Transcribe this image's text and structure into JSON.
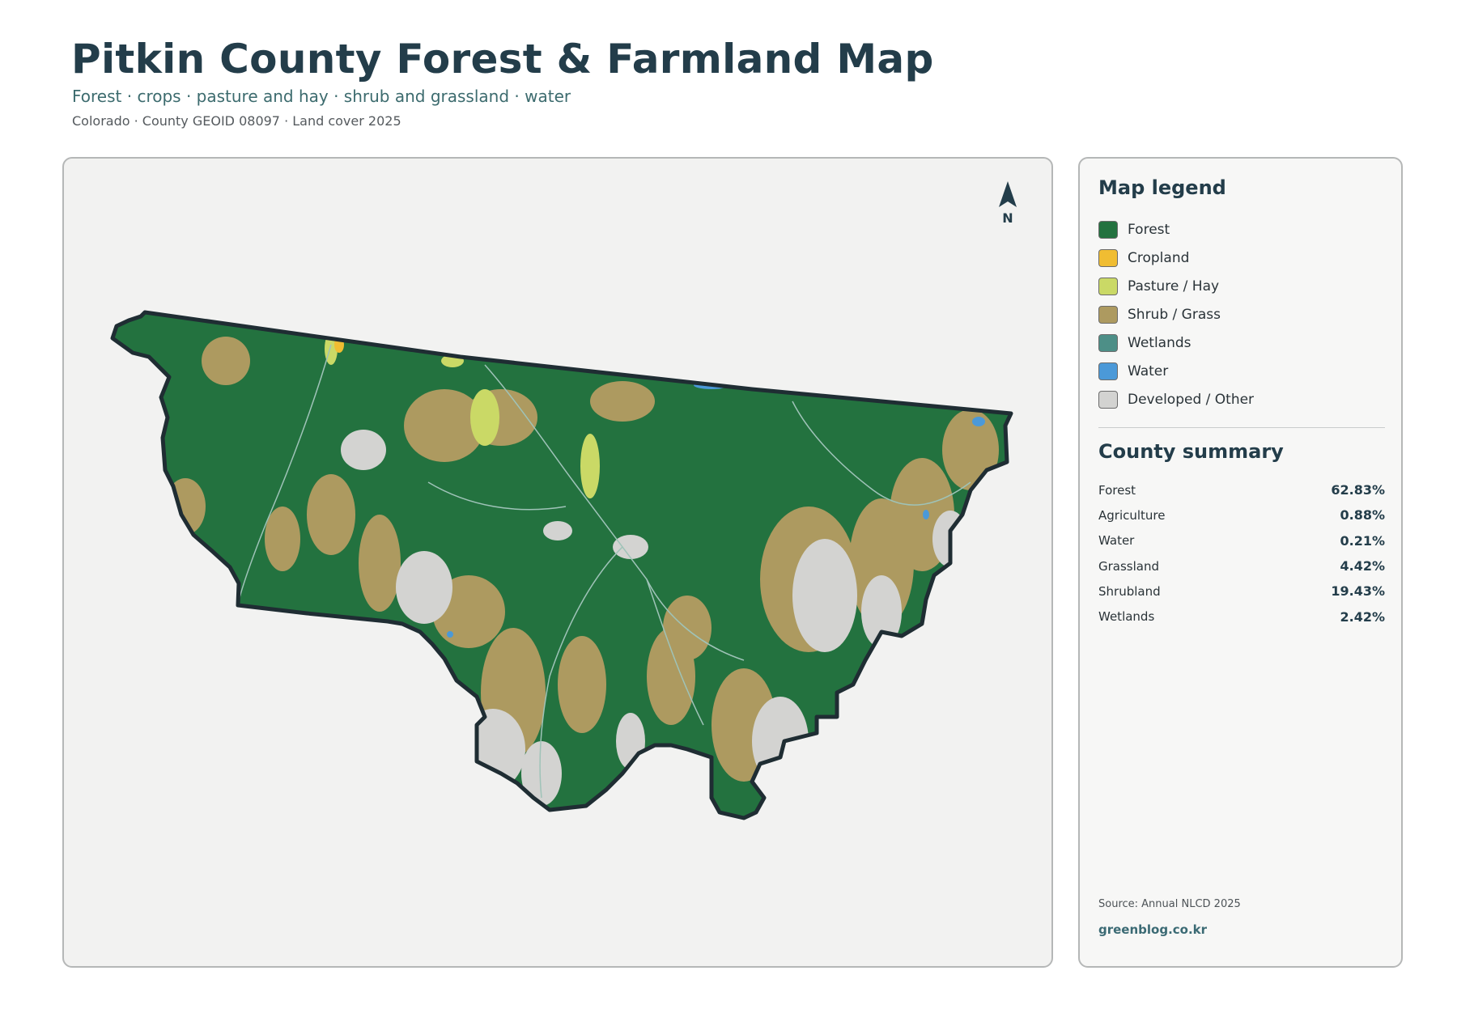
{
  "header": {
    "title": "Pitkin County Forest & Farmland Map",
    "subtitle": "Forest · crops · pasture and hay · shrub and grassland · water",
    "meta": "Colorado · County GEOID 08097 · Land cover 2025"
  },
  "map": {
    "north_label": "N"
  },
  "legend": {
    "title": "Map legend",
    "items": [
      {
        "label": "Forest",
        "color": "#23723f"
      },
      {
        "label": "Cropland",
        "color": "#f0bd32"
      },
      {
        "label": "Pasture / Hay",
        "color": "#cad966"
      },
      {
        "label": "Shrub / Grass",
        "color": "#ad9a60"
      },
      {
        "label": "Wetlands",
        "color": "#4d8f87"
      },
      {
        "label": "Water",
        "color": "#4b99d8"
      },
      {
        "label": "Developed / Other",
        "color": "#d3d3d1"
      }
    ]
  },
  "summary": {
    "title": "County summary",
    "rows": [
      {
        "name": "Forest",
        "value": "62.83%"
      },
      {
        "name": "Agriculture",
        "value": "0.88%"
      },
      {
        "name": "Water",
        "value": "0.21%"
      },
      {
        "name": "Grassland",
        "value": "4.42%"
      },
      {
        "name": "Shrubland",
        "value": "19.43%"
      },
      {
        "name": "Wetlands",
        "value": "2.42%"
      }
    ]
  },
  "footer": {
    "source": "Source: Annual NLCD 2025",
    "credit": "greenblog.co.kr"
  }
}
